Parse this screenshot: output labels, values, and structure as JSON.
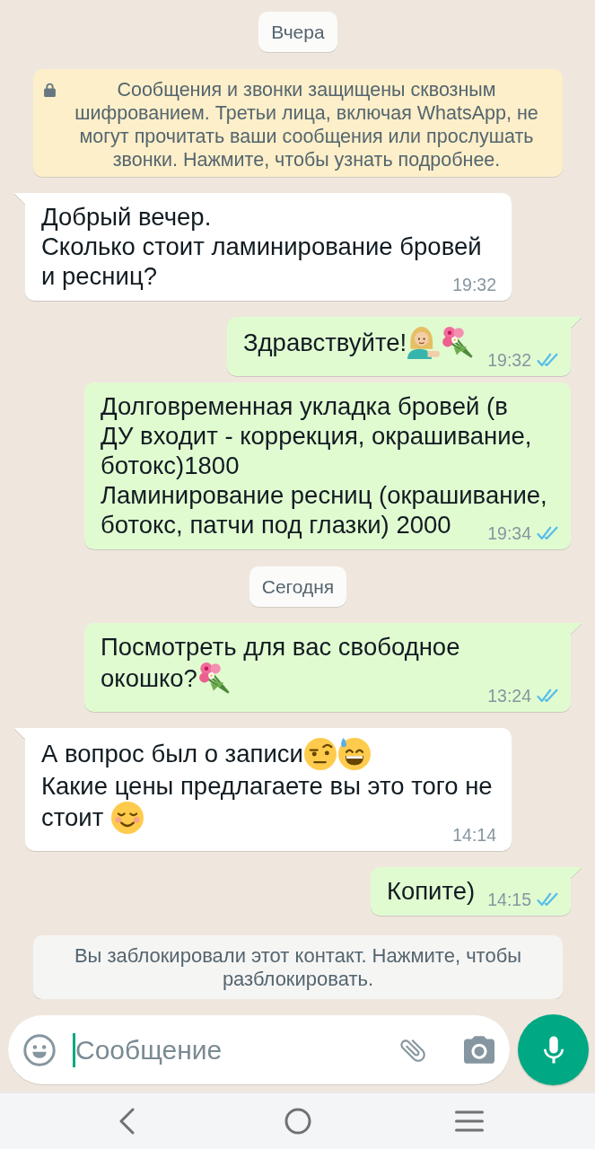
{
  "chat": [
    {
      "kind": "date",
      "text": "Вчера"
    },
    {
      "kind": "encryption",
      "text": "Сообщения и звонки защищены сквозным шифрованием. Третьи лица, включая WhatsApp, не могут прочитать ваши сообщения или прослушать звонки. Нажмите, чтобы узнать подробнее."
    },
    {
      "kind": "message",
      "outgoing": false,
      "tail": true,
      "lines": [
        {
          "text": "Добрый вечер."
        },
        {
          "text": "Сколько стоит ламинирование бровей"
        },
        {
          "text": "и ресниц?"
        }
      ],
      "time": "19:32"
    },
    {
      "kind": "message",
      "outgoing": true,
      "tail": true,
      "lines": [
        {
          "text": "Здравствуйте!",
          "emoji": [
            {
              "kind": "tipping"
            },
            {
              "kind": "bouquet"
            }
          ]
        }
      ],
      "time": "19:32",
      "read": true
    },
    {
      "kind": "message",
      "outgoing": true,
      "tail": false,
      "lines": [
        {
          "text": "Долговременная укладка бровей (в"
        },
        {
          "text": "ДУ входит - коррекция, окрашивание,"
        },
        {
          "text": "ботокс)1800"
        },
        {
          "text": "Ламинирование ресниц (окрашивание,"
        },
        {
          "text": "ботокс, патчи под глазки) 2000"
        }
      ],
      "time": "19:34",
      "read": true
    },
    {
      "kind": "date",
      "text": "Сегодня"
    },
    {
      "kind": "message",
      "outgoing": true,
      "tail": true,
      "lines": [
        {
          "text": "Посмотреть для вас свободное"
        },
        {
          "text": "окошко?",
          "emoji": [
            {
              "kind": "bouquet"
            }
          ]
        }
      ],
      "time": "13:24",
      "read": true
    },
    {
      "kind": "message",
      "outgoing": false,
      "tail": true,
      "lines": [
        {
          "text": "А вопрос был о записи",
          "emoji": [
            {
              "kind": "skeptical"
            },
            {
              "kind": "sweatsmile"
            }
          ]
        },
        {
          "text": "Какие цены предлагаете вы это того не"
        },
        {
          "text": "стоит ",
          "emoji": [
            {
              "kind": "smiling"
            }
          ]
        }
      ],
      "time": "14:14"
    },
    {
      "kind": "message",
      "outgoing": true,
      "tail": true,
      "lines": [
        {
          "text": "Копите)"
        }
      ],
      "time": "14:15",
      "read": true
    }
  ],
  "blocked_notice": {
    "text": "Вы заблокировали этот контакт. Нажмите, чтобы разблокировать."
  },
  "composer": {
    "placeholder": "Сообщение",
    "focused": true
  }
}
